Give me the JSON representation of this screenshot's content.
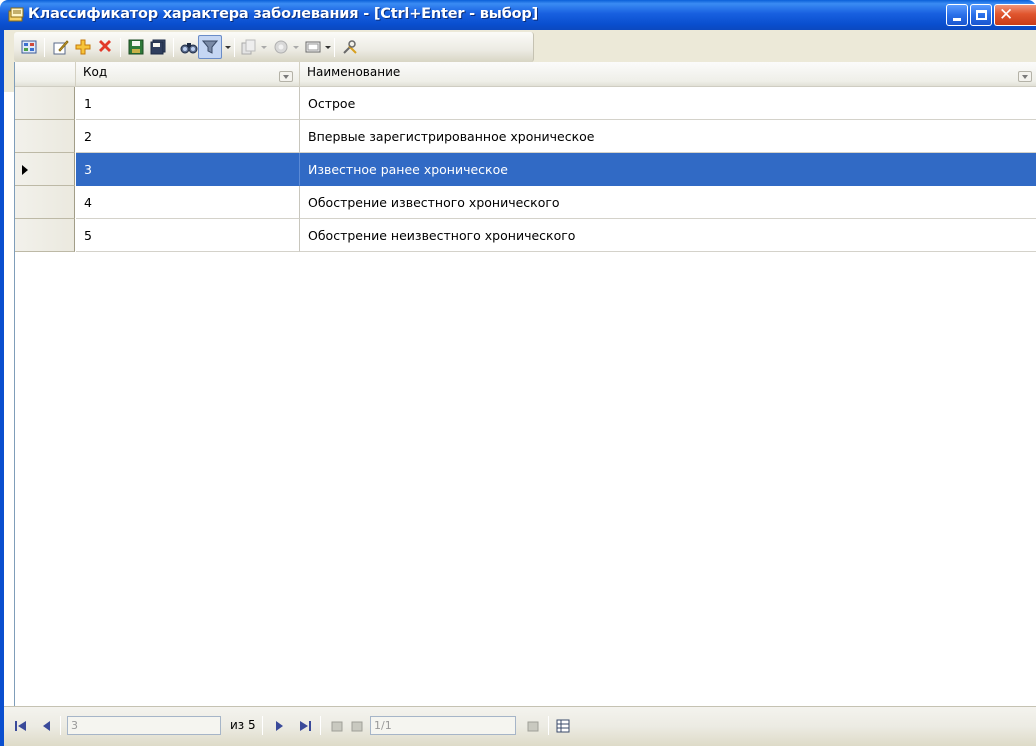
{
  "window": {
    "title": "Классификатор характера заболевания - [Ctrl+Enter - выбор]",
    "close_glyph": "✕"
  },
  "toolbar": {
    "icons": [
      "refresh-icon",
      "edit-icon",
      "add-icon",
      "delete-icon",
      "save-icon",
      "save-all-icon",
      "find-icon",
      "filter-icon",
      "copy-icon",
      "settings-icon",
      "view-icon",
      "tools-icon"
    ]
  },
  "grid": {
    "columns": [
      {
        "label": "Код"
      },
      {
        "label": "Наименование"
      }
    ],
    "rows": [
      {
        "code": "1",
        "name": "Острое"
      },
      {
        "code": "2",
        "name": "Впервые зарегистрированное хроническое"
      },
      {
        "code": "3",
        "name": "Известное ранее хроническое"
      },
      {
        "code": "4",
        "name": "Обострение известного хронического"
      },
      {
        "code": "5",
        "name": "Обострение неизвестного хронического"
      }
    ],
    "selected_index": 2,
    "colors": {
      "selection": "#316ac5",
      "title_bar": "#0a4fcf"
    }
  },
  "navigator": {
    "current_record": "3",
    "of_total": "из 5",
    "page_value": "1/1"
  }
}
